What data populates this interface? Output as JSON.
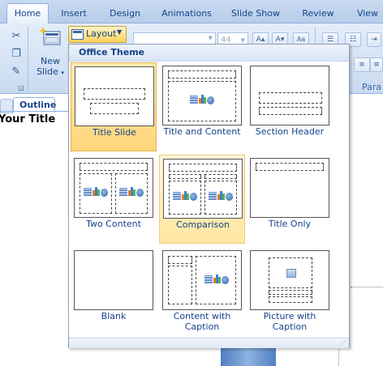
{
  "tabs": [
    {
      "label": "Home",
      "active": true
    },
    {
      "label": "Insert"
    },
    {
      "label": "Design"
    },
    {
      "label": "Animations"
    },
    {
      "label": "Slide Show"
    },
    {
      "label": "Review"
    },
    {
      "label": "View"
    }
  ],
  "ribbon": {
    "new_slide_label": "New Slide",
    "new_slide_line1": "New",
    "new_slide_line2": "Slide",
    "layout_label": "Layout",
    "font_size": "44",
    "grow_font": "A",
    "shrink_font": "A",
    "clear_format": "Aa",
    "paragraph_group_label": "Para"
  },
  "left_pane": {
    "outline_tab": "Outline",
    "slide_title": "Your Title"
  },
  "layout_gallery": {
    "header": "Office Theme",
    "items": [
      {
        "label": "Title Slide",
        "state": "selected"
      },
      {
        "label": "Title and Content"
      },
      {
        "label": "Section Header"
      },
      {
        "label": "Two Content"
      },
      {
        "label": "Comparison",
        "state": "hover"
      },
      {
        "label": "Title Only"
      },
      {
        "label": "Blank"
      },
      {
        "label": "Content with Caption"
      },
      {
        "label": "Picture with Caption"
      }
    ]
  },
  "colors": {
    "accent_selected": "#ffd57a",
    "tab_text": "#15428b",
    "ribbon_bg": "#c9daf0"
  }
}
